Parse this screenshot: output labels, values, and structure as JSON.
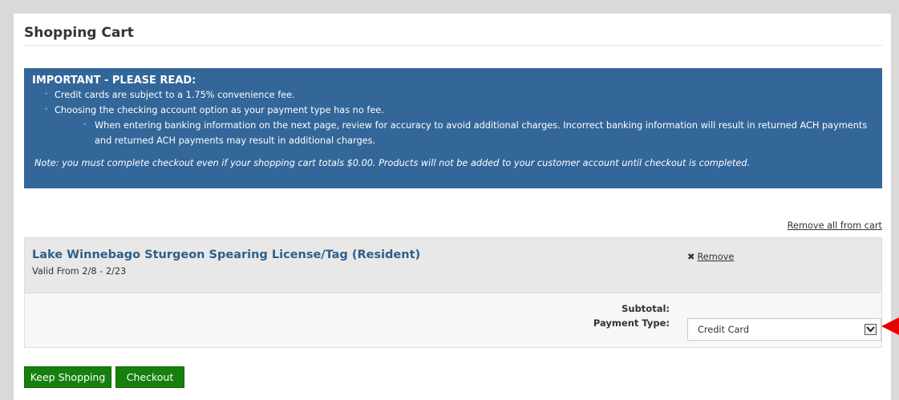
{
  "page": {
    "title": "Shopping Cart"
  },
  "notice": {
    "heading": "IMPORTANT - PLEASE READ:",
    "bullets": [
      "Credit cards are subject to a 1.75% convenience fee.",
      "Choosing the checking account option as your payment type has no fee."
    ],
    "sub_bullet": "When entering banking information on the next page, review for accuracy to avoid additional charges.  Incorrect banking information will result in returned ACH payments and returned ACH payments may result in additional charges.",
    "note": "Note: you must complete checkout even if your shopping cart totals $0.00.  Products will not be added to your customer account until checkout is completed.",
    "background_color": "#336699"
  },
  "cart": {
    "remove_all_label": "Remove all from cart",
    "items": [
      {
        "name": "Lake Winnebago Sturgeon Spearing License/Tag (Resident)",
        "valid": "Valid From 2/8 - 2/23",
        "remove_label": "Remove",
        "remove_icon": "x-icon"
      }
    ],
    "subtotal_label": "Subtotal:",
    "payment_type_label": "Payment Type:",
    "payment_type_value": "Credit Card"
  },
  "buttons": {
    "keep_shopping": "Keep Shopping",
    "checkout": "Checkout",
    "color": "#16800f"
  },
  "annotation": {
    "pointer_color": "#e60000"
  }
}
